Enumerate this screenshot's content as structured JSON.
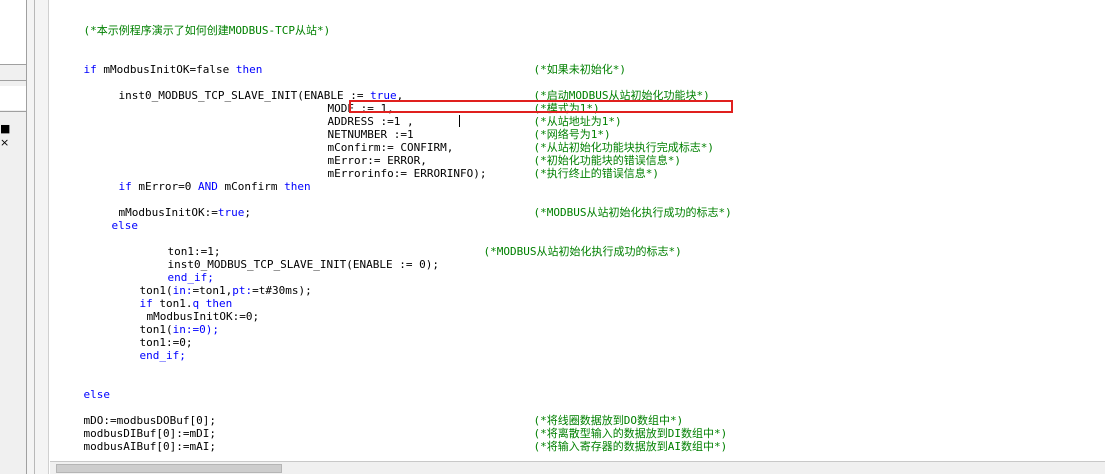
{
  "side_panel": {
    "pin_label": "■ ×"
  },
  "code": {
    "line01": {
      "comment": "(*本示例程序演示了如何创建MODBUS-TCP从站*)"
    },
    "line02": {
      "kw1": "if",
      "code": " mModbusInitOK=false ",
      "kw2": "then",
      "comment": "(*如果未初始化*)"
    },
    "line03": {
      "code": "inst0_MODBUS_TCP_SLAVE_INIT(ENABLE := ",
      "val": "true",
      "tail": ",",
      "comment": "(*启动MODBUS从站初始化功能块*)"
    },
    "line04": {
      "code": "MODE := 1,",
      "comment": "(*模式为1*)"
    },
    "line05": {
      "code": "ADDRESS :=1 ,",
      "comment": "(*从站地址为1*)"
    },
    "line06": {
      "code": "NETNUMBER :=1",
      "comment": "(*网络号为1*)"
    },
    "line07": {
      "code": "mConfirm:= CONFIRM,",
      "comment": "(*从站初始化功能块执行完成标志*)"
    },
    "line08": {
      "code": "mError:= ERROR,",
      "comment": "(*初始化功能块的错误信息*)"
    },
    "line09": {
      "code": "mErrorinfo:= ERRORINFO);",
      "comment": "(*执行终止的错误信息*)"
    },
    "line10": {
      "kw1": "if",
      "code": " mError=0 ",
      "kw2": "AND",
      "code2": " mConfirm ",
      "kw3": "then"
    },
    "line11": {
      "code": "mModbusInitOK:=",
      "val": "true",
      "tail": ";",
      "comment": "(*MODBUS从站初始化执行成功的标志*)"
    },
    "line12": {
      "kw": "else"
    },
    "line13": {
      "code": "ton1:=1;",
      "comment": "(*MODBUS从站初始化执行成功的标志*)"
    },
    "line14": {
      "code": "inst0_MODBUS_TCP_SLAVE_INIT(ENABLE := 0);"
    },
    "line15": {
      "kw": "end_if;"
    },
    "line16": {
      "code": "ton1(",
      "mid": "in:",
      "code2": "=ton1,",
      "mid2": "pt:",
      "code3": "=t#30ms);"
    },
    "line17": {
      "kw1": "if",
      "code": " ton1.",
      "mid": "q",
      "kw2": " then"
    },
    "line18": {
      "code": "mModbusInitOK:=0;"
    },
    "line19": {
      "code": "ton1(",
      "mid": "in:",
      "code2": "=0);"
    },
    "line20": {
      "code": "ton1:=0;"
    },
    "line21": {
      "kw": "end_if;"
    },
    "line22": {
      "kw": "else"
    },
    "line23": {
      "code": "mDO:=modbusDOBuf[0];",
      "comment": "(*将线圈数据放到DO数组中*)"
    },
    "line24": {
      "code": "modbusDIBuf[0]:=mDI;",
      "comment": "(*将离散型输入的数据放到DI数组中*)"
    },
    "line25": {
      "code": "modbusAIBuf[0]:=mAI;",
      "comment": "(*将输入寄存器的数据放到AI数组中*)"
    }
  },
  "colors": {
    "keyword": "#0000ff",
    "comment": "#008000",
    "highlight_box": "#e0201e"
  }
}
